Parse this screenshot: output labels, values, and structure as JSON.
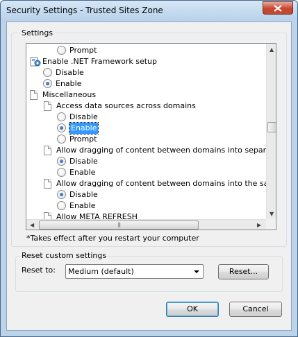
{
  "window": {
    "title": "Security Settings - Trusted Sites Zone"
  },
  "settings_group": {
    "label": "Settings"
  },
  "tree": {
    "rows": [
      {
        "kind": "radio",
        "label": "Prompt",
        "checked": false
      },
      {
        "kind": "category",
        "icon": "gear-page-icon",
        "label": "Enable .NET Framework setup"
      },
      {
        "kind": "radio",
        "label": "Disable",
        "checked": false
      },
      {
        "kind": "radio",
        "label": "Enable",
        "checked": true
      },
      {
        "kind": "category",
        "icon": "page-icon",
        "label": "Miscellaneous"
      },
      {
        "kind": "setting",
        "icon": "page-icon",
        "label": "Access data sources across domains"
      },
      {
        "kind": "radio",
        "label": "Disable",
        "checked": false
      },
      {
        "kind": "radio",
        "label": "Enable",
        "checked": true,
        "selected": true
      },
      {
        "kind": "radio",
        "label": "Prompt",
        "checked": false
      },
      {
        "kind": "setting",
        "icon": "page-icon",
        "label": "Allow dragging of content between domains into separate wi"
      },
      {
        "kind": "radio",
        "label": "Disable",
        "checked": true
      },
      {
        "kind": "radio",
        "label": "Enable",
        "checked": false
      },
      {
        "kind": "setting",
        "icon": "page-icon",
        "label": "Allow dragging of content between domains into the same wi"
      },
      {
        "kind": "radio",
        "label": "Disable",
        "checked": true
      },
      {
        "kind": "radio",
        "label": "Enable",
        "checked": false
      },
      {
        "kind": "setting",
        "icon": "page-icon",
        "label": "Allow META REFRESH"
      }
    ]
  },
  "note": "*Takes effect after you restart your computer",
  "reset_group": {
    "label": "Reset custom settings",
    "reset_to_label": "Reset to:",
    "selected_level": "Medium (default)",
    "reset_button": "Reset..."
  },
  "footer": {
    "ok": "OK",
    "cancel": "Cancel"
  },
  "colors": {
    "selection": "#3399ff",
    "titlebar": "#b9d1ea",
    "close": "#c8452f"
  }
}
